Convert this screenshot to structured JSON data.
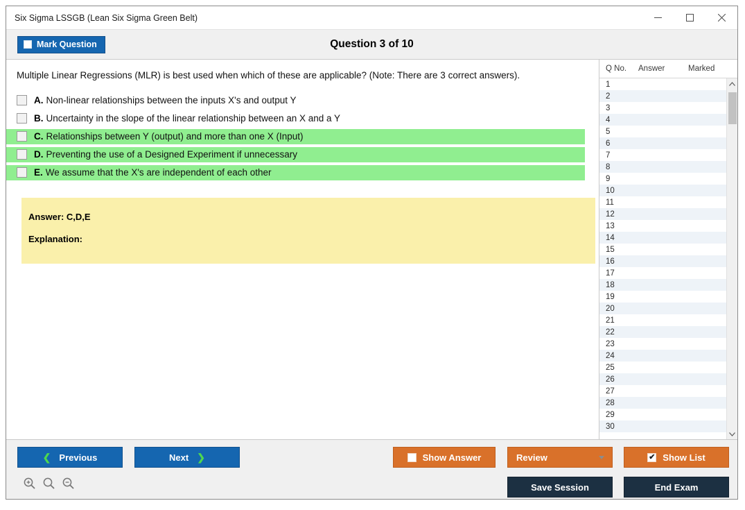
{
  "window": {
    "title": "Six Sigma LSSGB (Lean Six Sigma Green Belt)",
    "minimize_icon": "minimize-icon",
    "maximize_icon": "maximize-icon",
    "close_icon": "close-icon"
  },
  "header": {
    "mark_question_label": "Mark Question",
    "mark_question_checked": false,
    "question_title": "Question 3 of 10"
  },
  "question": {
    "text": "Multiple Linear Regressions (MLR) is best used when which of these are applicable? (Note: There are 3 correct answers).",
    "options": [
      {
        "letter": "A.",
        "text": "Non-linear relationships between the inputs X's and output Y",
        "correct": false,
        "checked": false
      },
      {
        "letter": "B.",
        "text": "Uncertainty in the slope of the linear relationship between an X and a Y",
        "correct": false,
        "checked": false
      },
      {
        "letter": "C.",
        "text": "Relationships between Y (output) and more than one X (Input)",
        "correct": true,
        "checked": false
      },
      {
        "letter": "D.",
        "text": "Preventing the use of a Designed Experiment if unnecessary",
        "correct": true,
        "checked": false
      },
      {
        "letter": "E.",
        "text": "We assume that the X's are independent of each other",
        "correct": true,
        "checked": false
      }
    ]
  },
  "answer_panel": {
    "answer_line": "Answer: C,D,E",
    "explanation_line": "Explanation:"
  },
  "question_list": {
    "columns": [
      "Q No.",
      "Answer",
      "Marked"
    ],
    "rows": [
      {
        "no": "1",
        "answer": "",
        "marked": ""
      },
      {
        "no": "2",
        "answer": "",
        "marked": ""
      },
      {
        "no": "3",
        "answer": "",
        "marked": ""
      },
      {
        "no": "4",
        "answer": "",
        "marked": ""
      },
      {
        "no": "5",
        "answer": "",
        "marked": ""
      },
      {
        "no": "6",
        "answer": "",
        "marked": ""
      },
      {
        "no": "7",
        "answer": "",
        "marked": ""
      },
      {
        "no": "8",
        "answer": "",
        "marked": ""
      },
      {
        "no": "9",
        "answer": "",
        "marked": ""
      },
      {
        "no": "10",
        "answer": "",
        "marked": ""
      },
      {
        "no": "11",
        "answer": "",
        "marked": ""
      },
      {
        "no": "12",
        "answer": "",
        "marked": ""
      },
      {
        "no": "13",
        "answer": "",
        "marked": ""
      },
      {
        "no": "14",
        "answer": "",
        "marked": ""
      },
      {
        "no": "15",
        "answer": "",
        "marked": ""
      },
      {
        "no": "16",
        "answer": "",
        "marked": ""
      },
      {
        "no": "17",
        "answer": "",
        "marked": ""
      },
      {
        "no": "18",
        "answer": "",
        "marked": ""
      },
      {
        "no": "19",
        "answer": "",
        "marked": ""
      },
      {
        "no": "20",
        "answer": "",
        "marked": ""
      },
      {
        "no": "21",
        "answer": "",
        "marked": ""
      },
      {
        "no": "22",
        "answer": "",
        "marked": ""
      },
      {
        "no": "23",
        "answer": "",
        "marked": ""
      },
      {
        "no": "24",
        "answer": "",
        "marked": ""
      },
      {
        "no": "25",
        "answer": "",
        "marked": ""
      },
      {
        "no": "26",
        "answer": "",
        "marked": ""
      },
      {
        "no": "27",
        "answer": "",
        "marked": ""
      },
      {
        "no": "28",
        "answer": "",
        "marked": ""
      },
      {
        "no": "29",
        "answer": "",
        "marked": ""
      },
      {
        "no": "30",
        "answer": "",
        "marked": ""
      }
    ],
    "scroll_up_icon": "chevron-up-icon",
    "scroll_down_icon": "chevron-down-icon"
  },
  "footer": {
    "previous_label": "Previous",
    "next_label": "Next",
    "show_answer_label": "Show Answer",
    "show_answer_checked": false,
    "review_label": "Review",
    "show_list_label": "Show List",
    "show_list_checked": true,
    "show_list_check_glyph": "✔",
    "save_session_label": "Save Session",
    "end_exam_label": "End Exam",
    "zoom_in_icon": "zoom-in-icon",
    "zoom_reset_icon": "zoom-reset-icon",
    "zoom_out_icon": "zoom-out-icon"
  },
  "colors": {
    "primary_blue": "#1566b0",
    "orange": "#d9712a",
    "navy": "#1c3042",
    "correct_green": "#90ee90",
    "answer_yellow": "#faf0ab",
    "chevron_green": "#4ed94e"
  }
}
